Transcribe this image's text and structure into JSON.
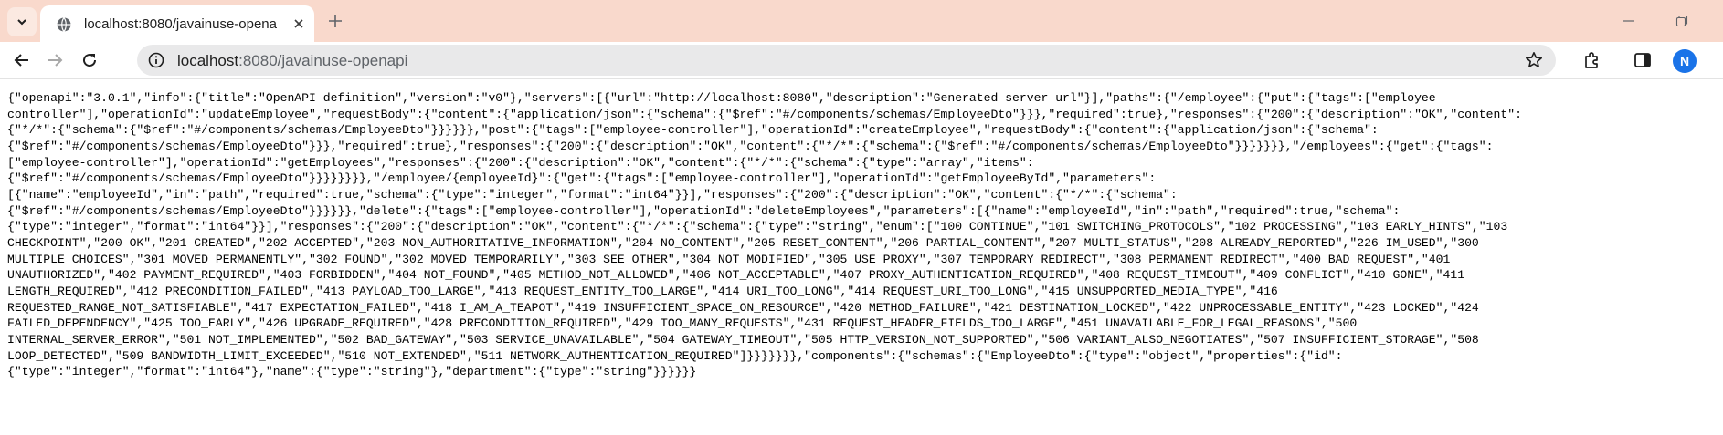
{
  "browser": {
    "tab": {
      "title": "localhost:8080/javainuse-opena"
    },
    "url": {
      "host": "localhost",
      "rest": ":8080/javainuse-openapi"
    },
    "profile_initial": "N"
  },
  "colors": {
    "tabstrip_bg": "#f9d9cc",
    "omnibox_bg": "#e9e9ea",
    "avatar_bg": "#1a73e8"
  },
  "icons": [
    "tab-search-icon",
    "globe-icon",
    "close-icon",
    "plus-icon",
    "minimize-icon",
    "restore-icon",
    "back-arrow-icon",
    "forward-arrow-icon",
    "reload-icon",
    "info-icon",
    "star-icon",
    "extensions-icon",
    "side-panel-icon"
  ],
  "content": {
    "lines": [
      "{\"openapi\":\"3.0.1\",\"info\":{\"title\":\"OpenAPI definition\",\"version\":\"v0\"},\"servers\":[{\"url\":\"http://localhost:8080\",\"description\":\"Generated server url\"}],\"paths\":{\"/employee\":{\"put\":{\"tags\":[\"employee-",
      "controller\"],\"operationId\":\"updateEmployee\",\"requestBody\":{\"content\":{\"application/json\":{\"schema\":{\"$ref\":\"#/components/schemas/EmployeeDto\"}}},\"required\":true},\"responses\":{\"200\":{\"description\":\"OK\",\"content\":",
      "{\"*/*\":{\"schema\":{\"$ref\":\"#/components/schemas/EmployeeDto\"}}}}}},\"post\":{\"tags\":[\"employee-controller\"],\"operationId\":\"createEmployee\",\"requestBody\":{\"content\":{\"application/json\":{\"schema\":",
      "{\"$ref\":\"#/components/schemas/EmployeeDto\"}}},\"required\":true},\"responses\":{\"200\":{\"description\":\"OK\",\"content\":{\"*/*\":{\"schema\":{\"$ref\":\"#/components/schemas/EmployeeDto\"}}}}}}},\"/employees\":{\"get\":{\"tags\":",
      "[\"employee-controller\"],\"operationId\":\"getEmployees\",\"responses\":{\"200\":{\"description\":\"OK\",\"content\":{\"*/*\":{\"schema\":{\"type\":\"array\",\"items\":",
      "{\"$ref\":\"#/components/schemas/EmployeeDto\"}}}}}}}},\"/employee/{employeeId}\":{\"get\":{\"tags\":[\"employee-controller\"],\"operationId\":\"getEmployeeById\",\"parameters\":",
      "[{\"name\":\"employeeId\",\"in\":\"path\",\"required\":true,\"schema\":{\"type\":\"integer\",\"format\":\"int64\"}}],\"responses\":{\"200\":{\"description\":\"OK\",\"content\":{\"*/*\":{\"schema\":",
      "{\"$ref\":\"#/components/schemas/EmployeeDto\"}}}}}},\"delete\":{\"tags\":[\"employee-controller\"],\"operationId\":\"deleteEmployees\",\"parameters\":[{\"name\":\"employeeId\",\"in\":\"path\",\"required\":true,\"schema\":",
      "{\"type\":\"integer\",\"format\":\"int64\"}}],\"responses\":{\"200\":{\"description\":\"OK\",\"content\":{\"*/*\":{\"schema\":{\"type\":\"string\",\"enum\":[\"100 CONTINUE\",\"101 SWITCHING_PROTOCOLS\",\"102 PROCESSING\",\"103 EARLY_HINTS\",\"103",
      "CHECKPOINT\",\"200 OK\",\"201 CREATED\",\"202 ACCEPTED\",\"203 NON_AUTHORITATIVE_INFORMATION\",\"204 NO_CONTENT\",\"205 RESET_CONTENT\",\"206 PARTIAL_CONTENT\",\"207 MULTI_STATUS\",\"208 ALREADY_REPORTED\",\"226 IM_USED\",\"300",
      "MULTIPLE_CHOICES\",\"301 MOVED_PERMANENTLY\",\"302 FOUND\",\"302 MOVED_TEMPORARILY\",\"303 SEE_OTHER\",\"304 NOT_MODIFIED\",\"305 USE_PROXY\",\"307 TEMPORARY_REDIRECT\",\"308 PERMANENT_REDIRECT\",\"400 BAD_REQUEST\",\"401",
      "UNAUTHORIZED\",\"402 PAYMENT_REQUIRED\",\"403 FORBIDDEN\",\"404 NOT_FOUND\",\"405 METHOD_NOT_ALLOWED\",\"406 NOT_ACCEPTABLE\",\"407 PROXY_AUTHENTICATION_REQUIRED\",\"408 REQUEST_TIMEOUT\",\"409 CONFLICT\",\"410 GONE\",\"411",
      "LENGTH_REQUIRED\",\"412 PRECONDITION_FAILED\",\"413 PAYLOAD_TOO_LARGE\",\"413 REQUEST_ENTITY_TOO_LARGE\",\"414 URI_TOO_LONG\",\"414 REQUEST_URI_TOO_LONG\",\"415 UNSUPPORTED_MEDIA_TYPE\",\"416",
      "REQUESTED_RANGE_NOT_SATISFIABLE\",\"417 EXPECTATION_FAILED\",\"418 I_AM_A_TEAPOT\",\"419 INSUFFICIENT_SPACE_ON_RESOURCE\",\"420 METHOD_FAILURE\",\"421 DESTINATION_LOCKED\",\"422 UNPROCESSABLE_ENTITY\",\"423 LOCKED\",\"424",
      "FAILED_DEPENDENCY\",\"425 TOO_EARLY\",\"426 UPGRADE_REQUIRED\",\"428 PRECONDITION_REQUIRED\",\"429 TOO_MANY_REQUESTS\",\"431 REQUEST_HEADER_FIELDS_TOO_LARGE\",\"451 UNAVAILABLE_FOR_LEGAL_REASONS\",\"500",
      "INTERNAL_SERVER_ERROR\",\"501 NOT_IMPLEMENTED\",\"502 BAD_GATEWAY\",\"503 SERVICE_UNAVAILABLE\",\"504 GATEWAY_TIMEOUT\",\"505 HTTP_VERSION_NOT_SUPPORTED\",\"506 VARIANT_ALSO_NEGOTIATES\",\"507 INSUFFICIENT_STORAGE\",\"508",
      "LOOP_DETECTED\",\"509 BANDWIDTH_LIMIT_EXCEEDED\",\"510 NOT_EXTENDED\",\"511 NETWORK_AUTHENTICATION_REQUIRED\"]}}}}}}},\"components\":{\"schemas\":{\"EmployeeDto\":{\"type\":\"object\",\"properties\":{\"id\":",
      "{\"type\":\"integer\",\"format\":\"int64\"},\"name\":{\"type\":\"string\"},\"department\":{\"type\":\"string\"}}}}}}"
    ]
  }
}
